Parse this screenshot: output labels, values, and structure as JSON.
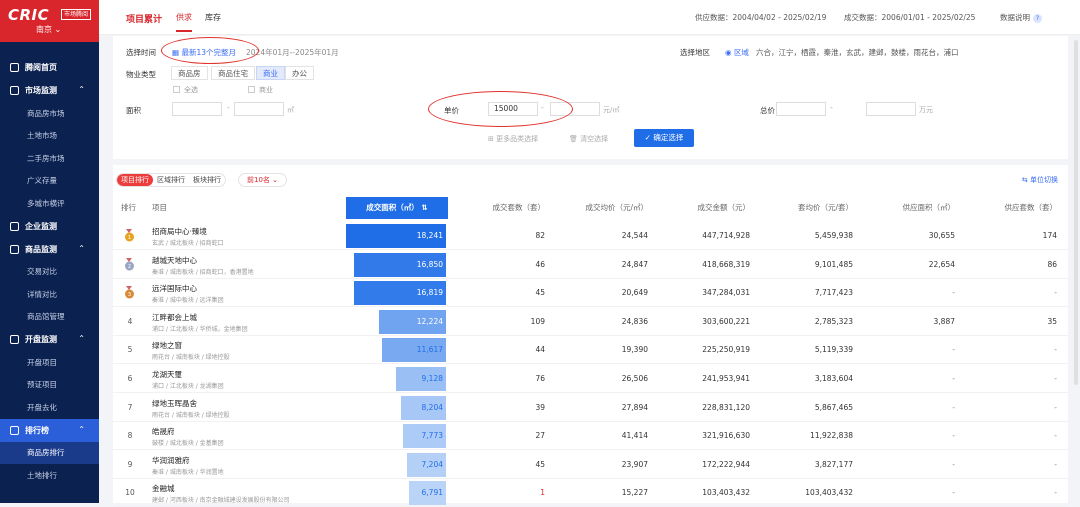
{
  "sidebar": {
    "logo": "CRIC",
    "logo_sub": "市场腾阅",
    "city": "南京 ⌄",
    "groups": [
      {
        "label": "腾阅首页",
        "icon": "home-icon",
        "items": []
      },
      {
        "label": "市场监测",
        "icon": "calendar-icon",
        "items": [
          "商品房市场",
          "土地市场",
          "二手房市场",
          "广义存量",
          "多城市横评"
        ]
      },
      {
        "label": "企业监测",
        "icon": "briefcase-icon",
        "items": []
      },
      {
        "label": "商品监测",
        "icon": "grid-icon",
        "items": [
          "交易对比",
          "详情对比",
          "商品馆管理"
        ]
      },
      {
        "label": "开盘监测",
        "icon": "target-icon",
        "items": [
          "开盘项目",
          "预证项目",
          "开盘去化"
        ]
      },
      {
        "label": "排行榜",
        "icon": "chart-icon",
        "items": [
          "商品房排行",
          "土地排行"
        ]
      }
    ]
  },
  "header": {
    "title": "项目累计",
    "tabs": [
      "供求",
      "库存"
    ],
    "supply_label": "供应数据：",
    "supply_range": "2004/04/02 - 2025/02/19",
    "deal_label": "成交数据：",
    "deal_range": "2006/01/01 - 2025/02/25",
    "help_label": "数据说明",
    "help_icon": "?"
  },
  "filter": {
    "time_label": "选择时间",
    "time_value": "最新13个完整月",
    "time_range": "2024年01月--2025年01月",
    "region_label": "选择地区",
    "region_value": "区域",
    "region_list": "六合，江宁，栖霞，秦淮，玄武，建邺，鼓楼，雨花台，浦口",
    "type_label": "物业类型",
    "types": [
      "商品房",
      "商品住宅",
      "商业",
      "办公"
    ],
    "check_all": "全选",
    "check_commercial": "商业",
    "area_label": "面积",
    "area_unit": "㎡",
    "price_label": "单价",
    "price_from": "15000",
    "price_unit": "元/㎡",
    "total_label": "总价",
    "total_unit": "万元",
    "dash": "-",
    "more_label": "更多品类选择",
    "clear_label": "清空选择",
    "confirm_label": "确定选择"
  },
  "ranking": {
    "tabs": [
      "项目排行",
      "区域排行",
      "板块排行"
    ],
    "topn": "前10名 ⌄",
    "unit_switch": "单位切换",
    "headers": {
      "rank": "排行",
      "project": "项目",
      "area": "成交面积（㎡）",
      "count": "成交套数（套）",
      "avg_price": "成交均价（元/㎡）",
      "amount": "成交金额（元）",
      "unit_price": "套均价（元/套）",
      "supply_area": "供应面积（㎡）",
      "supply_count": "供应套数（套）"
    },
    "rows": [
      {
        "rank": "1",
        "medal": "gold",
        "name": "招商局中心·臻境",
        "desc": "玄武 / 城北板块 / 招商蛇口",
        "area": 18241,
        "area_text": "18,241",
        "count": "82",
        "avg": "24,544",
        "amount": "447,714,928",
        "per": "5,459,938",
        "sup_area": "30,655",
        "sup_count": "174"
      },
      {
        "rank": "2",
        "medal": "silver",
        "name": "越城天地中心",
        "desc": "秦淮 / 城南板块 / 招商蛇口，香港置地",
        "area": 16850,
        "area_text": "16,850",
        "count": "46",
        "avg": "24,847",
        "amount": "418,668,319",
        "per": "9,101,485",
        "sup_area": "22,654",
        "sup_count": "86"
      },
      {
        "rank": "3",
        "medal": "bronze",
        "name": "远洋国际中心",
        "desc": "秦淮 / 城中板块 / 远洋集团",
        "area": 16819,
        "area_text": "16,819",
        "count": "45",
        "avg": "20,649",
        "amount": "347,284,031",
        "per": "7,717,423",
        "sup_area": "-",
        "sup_count": "-"
      },
      {
        "rank": "4",
        "medal": "",
        "name": "江畔都会上城",
        "desc": "浦口 / 江北板块 / 华侨城，金地集团",
        "area": 12224,
        "area_text": "12,224",
        "count": "109",
        "avg": "24,836",
        "amount": "303,600,221",
        "per": "2,785,323",
        "sup_area": "3,887",
        "sup_count": "35"
      },
      {
        "rank": "5",
        "medal": "",
        "name": "绿地之窗",
        "desc": "雨花台 / 城南板块 / 绿地控股",
        "area": 11617,
        "area_text": "11,617",
        "count": "44",
        "avg": "19,390",
        "amount": "225,250,919",
        "per": "5,119,339",
        "sup_area": "-",
        "sup_count": "-"
      },
      {
        "rank": "6",
        "medal": "",
        "name": "龙湖天璽",
        "desc": "浦口 / 江北板块 / 龙湖集团",
        "area": 9128,
        "area_text": "9,128",
        "count": "76",
        "avg": "26,506",
        "amount": "241,953,941",
        "per": "3,183,604",
        "sup_area": "-",
        "sup_count": "-"
      },
      {
        "rank": "7",
        "medal": "",
        "name": "绿地玉晖晶舍",
        "desc": "雨花台 / 城南板块 / 绿地控股",
        "area": 8204,
        "area_text": "8,204",
        "count": "39",
        "avg": "27,894",
        "amount": "228,831,120",
        "per": "5,867,465",
        "sup_area": "-",
        "sup_count": "-"
      },
      {
        "rank": "8",
        "medal": "",
        "name": "皓晟府",
        "desc": "鼓楼 / 城北板块 / 金基集团",
        "area": 7773,
        "area_text": "7,773",
        "count": "27",
        "avg": "41,414",
        "amount": "321,916,630",
        "per": "11,922,838",
        "sup_area": "-",
        "sup_count": "-"
      },
      {
        "rank": "9",
        "medal": "",
        "name": "华润润雅府",
        "desc": "秦淮 / 城南板块 / 华润置地",
        "area": 7204,
        "area_text": "7,204",
        "count": "45",
        "avg": "23,907",
        "amount": "172,222,944",
        "per": "3,827,177",
        "sup_area": "-",
        "sup_count": "-"
      },
      {
        "rank": "10",
        "medal": "",
        "name": "金融城",
        "desc": "建邺 / 河西板块 / 南京金融城建设发展股份有限公司",
        "area": 6791,
        "area_text": "6,791",
        "count": "1",
        "avg": "15,227",
        "amount": "103,403,432",
        "per": "103,403,432",
        "sup_area": "-",
        "sup_count": "-"
      }
    ]
  },
  "colors": {
    "brand": "#d8262c",
    "accent": "#1f6ee8",
    "sidebar": "#0b2150",
    "annotation": "#e0322b"
  }
}
